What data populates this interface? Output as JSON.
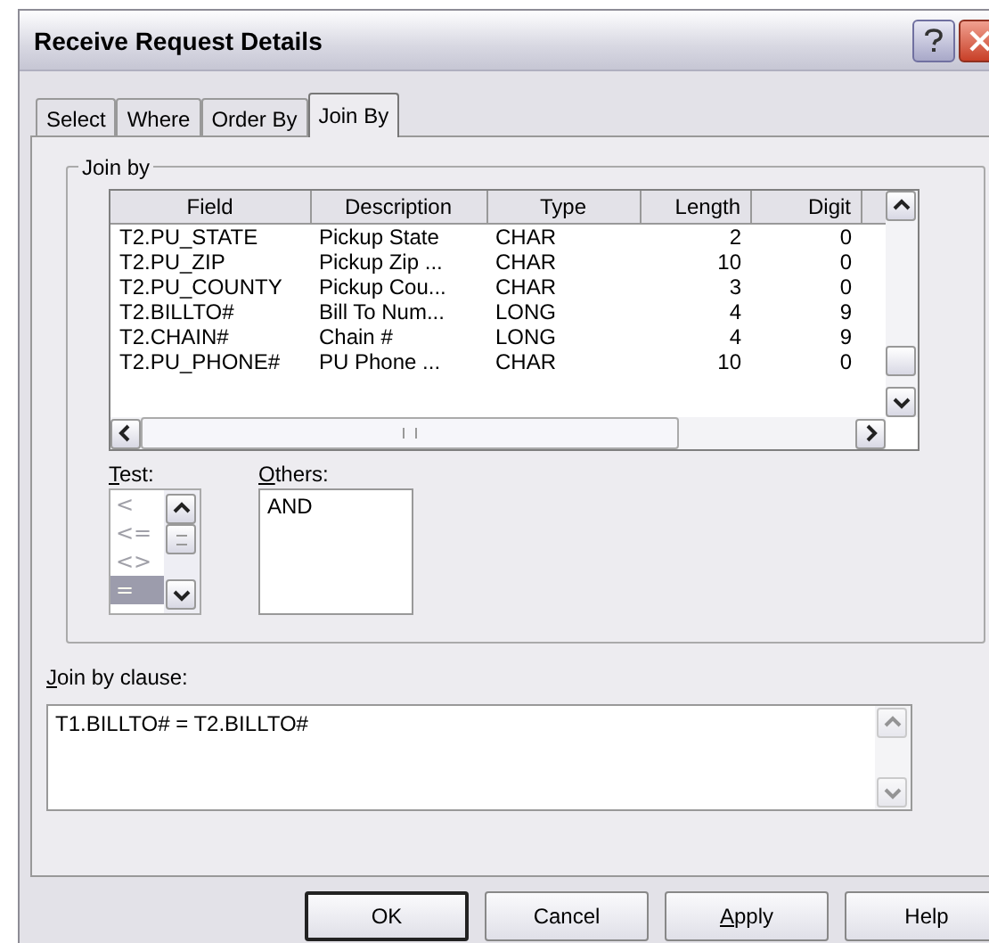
{
  "window": {
    "title": "Receive Request Details"
  },
  "tabs": [
    {
      "label": "Select",
      "selected": false
    },
    {
      "label": "Where",
      "selected": false
    },
    {
      "label": "Order By",
      "selected": false
    },
    {
      "label": "Join By",
      "selected": true
    }
  ],
  "join_by": {
    "title": "Join by",
    "table": {
      "columns": [
        {
          "label": "Field"
        },
        {
          "label": "Description"
        },
        {
          "label": "Type"
        },
        {
          "label": "Length"
        },
        {
          "label": "Digit"
        }
      ],
      "rows": [
        [
          "T2.PU_STATE",
          "Pickup State",
          "CHAR",
          "2",
          "0"
        ],
        [
          "T2.PU_ZIP",
          "Pickup Zip ...",
          "CHAR",
          "10",
          "0"
        ],
        [
          "T2.PU_COUNTY",
          "Pickup Cou...",
          "CHAR",
          "3",
          "0"
        ],
        [
          "T2.BILLTO#",
          "Bill To Num...",
          "LONG",
          "4",
          "9"
        ],
        [
          "T2.CHAIN#",
          "Chain #",
          "LONG",
          "4",
          "9"
        ],
        [
          "T2.PU_PHONE#",
          "PU Phone ...",
          "CHAR",
          "10",
          "0"
        ]
      ]
    },
    "test": {
      "label": "Test:",
      "mnemonic": true,
      "disabled": true,
      "items": [
        {
          "text": "<",
          "selected": false
        },
        {
          "text": "<=",
          "selected": false
        },
        {
          "text": "<>",
          "selected": false
        },
        {
          "text": "=",
          "selected": true
        }
      ]
    },
    "others": {
      "label": "Others:",
      "mnemonic": true,
      "items": [
        {
          "text": "AND",
          "selected": false
        }
      ]
    }
  },
  "clause": {
    "label": "Join by clause:",
    "mnemonic": true,
    "value": "T1.BILLTO# = T2.BILLTO#"
  },
  "buttons": [
    {
      "label": "OK",
      "default": true,
      "mnemonic": false
    },
    {
      "label": "Cancel",
      "default": false,
      "mnemonic": false
    },
    {
      "label": "Apply",
      "default": false,
      "mnemonic": true
    },
    {
      "label": "Help",
      "default": false,
      "mnemonic": false
    }
  ]
}
